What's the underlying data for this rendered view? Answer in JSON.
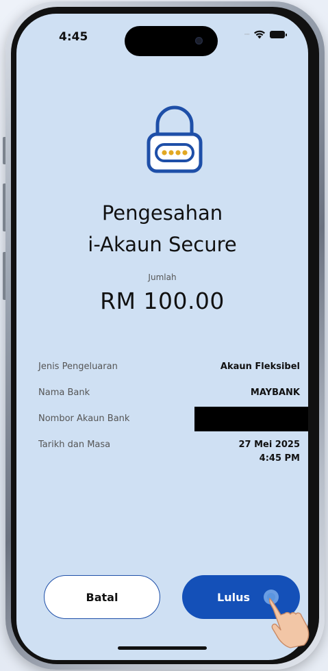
{
  "status_bar": {
    "time": "4:45"
  },
  "dialog": {
    "icon": "lock-icon",
    "title_line1": "Pengesahan",
    "title_line2": "i-Akaun Secure",
    "amount_label": "Jumlah",
    "amount_value": "RM 100.00"
  },
  "details": [
    {
      "label": "Jenis Pengeluaran",
      "value": "Akaun Fleksibel"
    },
    {
      "label": "Nama Bank",
      "value": "MAYBANK"
    },
    {
      "label": "Nombor Akaun Bank",
      "value": ""
    },
    {
      "label": "Tarikh dan Masa",
      "value": "27 Mei 2025",
      "value2": "4:45 PM"
    }
  ],
  "actions": {
    "cancel_label": "Batal",
    "approve_label": "Lulus"
  },
  "colors": {
    "screen_bg": "#cfe0f3",
    "primary": "#1450b8",
    "lock_outline": "#1e4fa8",
    "lock_dots": "#e2a822"
  }
}
